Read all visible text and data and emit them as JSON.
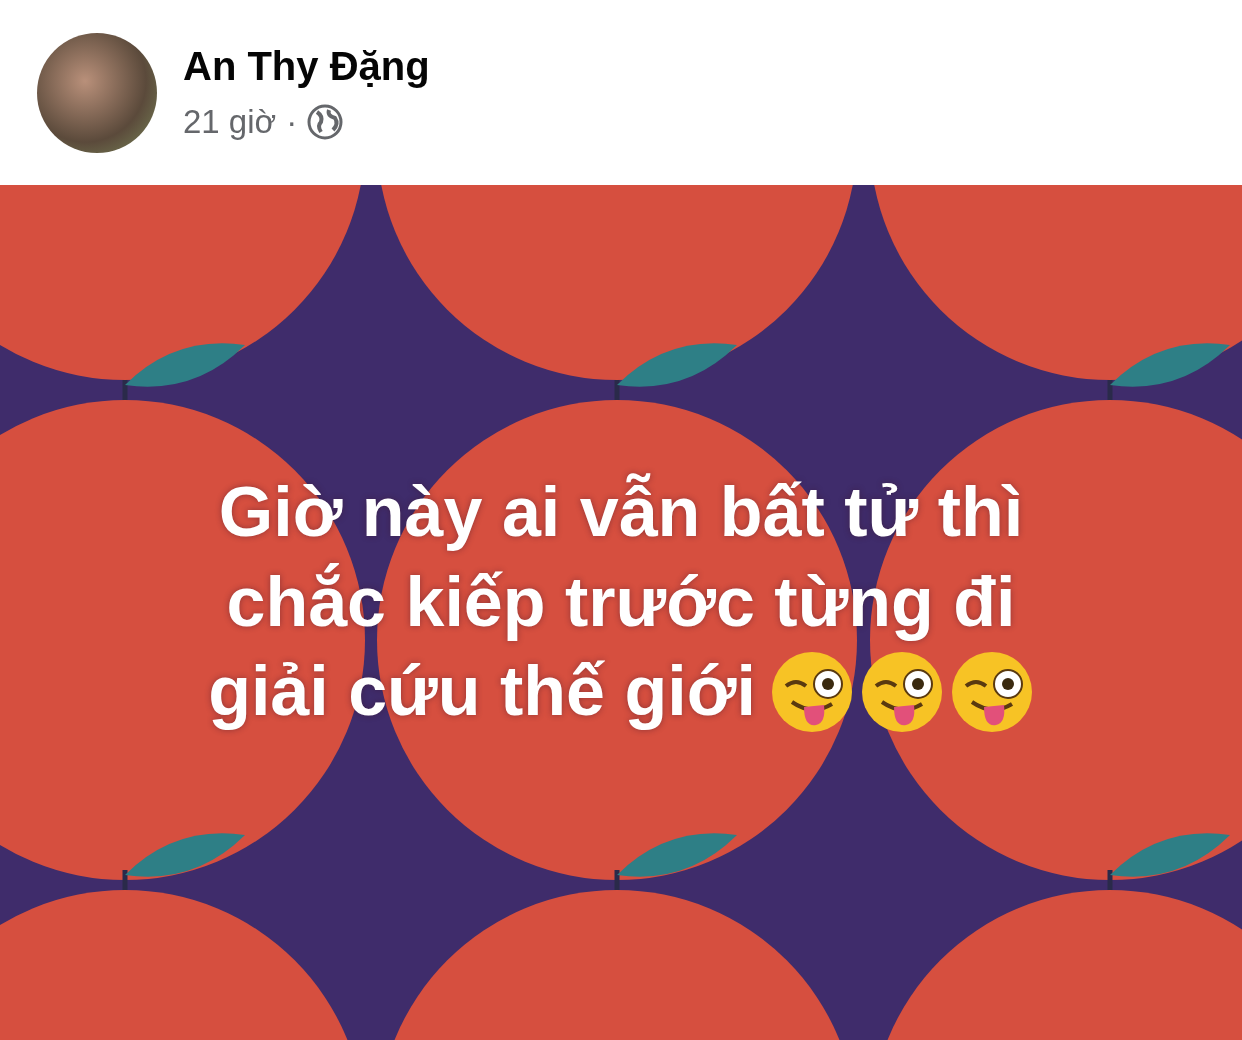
{
  "author": {
    "name": "An Thy Đặng",
    "time": "21 giờ",
    "separator": "·"
  },
  "post": {
    "lines": [
      "Giờ này ai vẫn bất tử thì",
      "chắc kiếp trước từng đi",
      "giải cứu thế giới"
    ],
    "emojis": [
      {
        "kind": "wink-tongue"
      },
      {
        "kind": "wink-tongue"
      },
      {
        "kind": "wink-tongue"
      }
    ]
  }
}
